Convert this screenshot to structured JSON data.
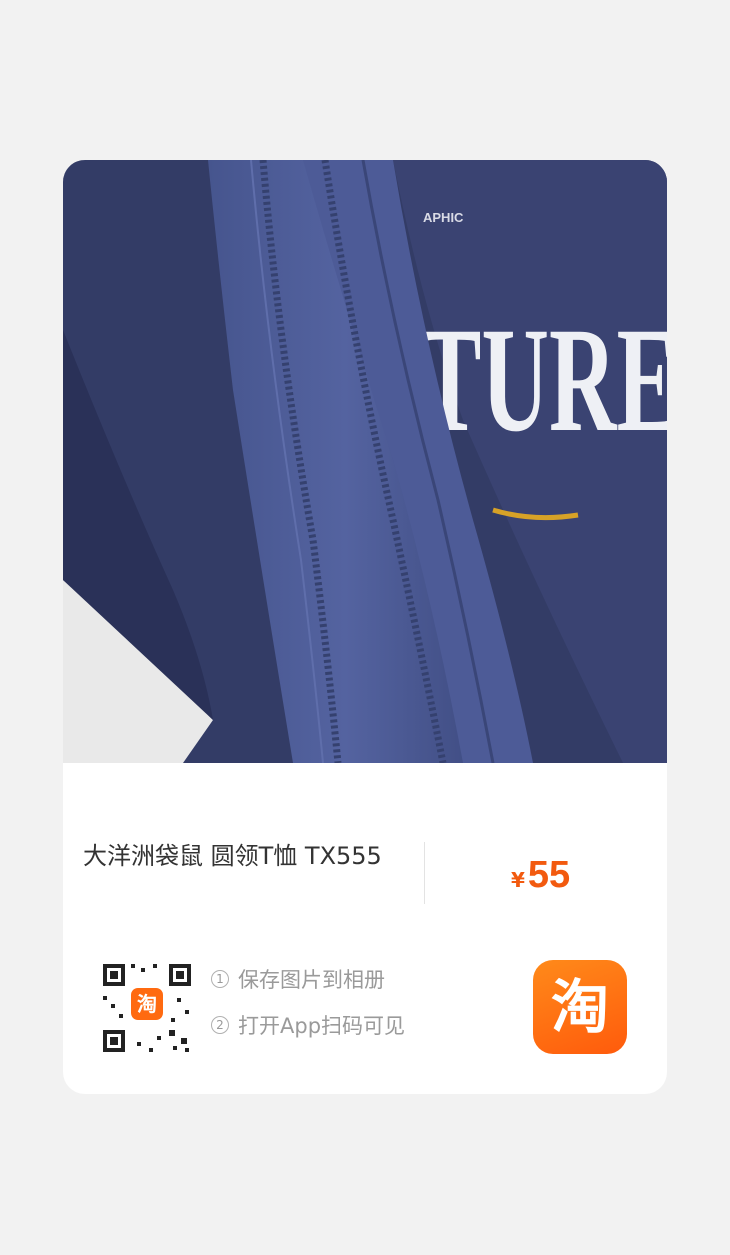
{
  "product": {
    "title": "大洋洲袋鼠 圆领T恤 TX555",
    "currency_symbol": "¥",
    "price": "55",
    "image_text": "TURE",
    "image_small_text": "APHIC"
  },
  "share": {
    "qr_badge": "淘",
    "steps": [
      {
        "num": "1",
        "text": "保存图片到相册"
      },
      {
        "num": "2",
        "text": "打开App扫码可见"
      }
    ],
    "app_logo": "淘"
  },
  "colors": {
    "accent": "#f25a0f",
    "fabric": "#3b4571"
  }
}
